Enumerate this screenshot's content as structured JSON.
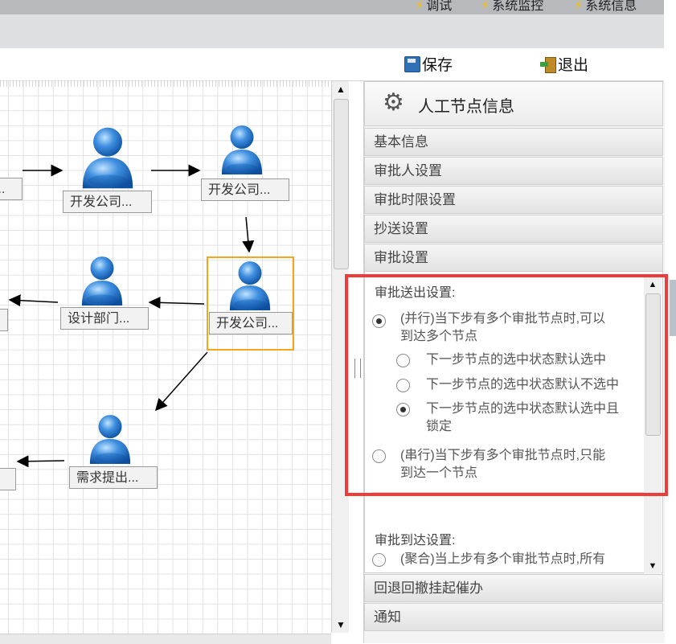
{
  "topbar": {
    "links": [
      {
        "label": "调试"
      },
      {
        "label": "系统监控"
      },
      {
        "label": "系统信息"
      }
    ]
  },
  "toolbar": {
    "save_label": "保存",
    "exit_label": "退出"
  },
  "workflow": {
    "nodes": [
      {
        "label": "..."
      },
      {
        "label": "开发公司..."
      },
      {
        "label": "开发公司..."
      },
      {
        "label": ""
      },
      {
        "label": "设计部门..."
      },
      {
        "label": "开发公司..."
      },
      {
        "label": "需求提出..."
      },
      {
        "label": "."
      }
    ]
  },
  "panel": {
    "title": "人工节点信息",
    "accordion": [
      {
        "label": "基本信息"
      },
      {
        "label": "审批人设置"
      },
      {
        "label": "审批时限设置"
      },
      {
        "label": "抄送设置"
      },
      {
        "label": "审批设置"
      }
    ],
    "send_settings": {
      "title": "审批送出设置:",
      "parallel": {
        "line1": "(并行)当下步有多个审批节点时,可以",
        "line2": "到达多个节点",
        "selected": true
      },
      "sub_options": [
        {
          "label": "下一步节点的选中状态默认选中",
          "selected": false
        },
        {
          "label": "下一步节点的选中状态默认不选中",
          "selected": false
        },
        {
          "label1": "下一步节点的选中状态默认选中且",
          "label2": "锁定",
          "selected": true
        }
      ],
      "serial": {
        "line1": "(串行)当下步有多个审批节点时,只能",
        "line2": "到达一个节点",
        "selected": false
      }
    },
    "arrive_settings": {
      "title": "审批到达设置:",
      "merge": {
        "line1": "(聚合)当上步有多个审批节点时,所有",
        "selected": false
      }
    },
    "accordion_bottom": [
      {
        "label": "回退回撤挂起催办"
      },
      {
        "label": "通知"
      }
    ]
  }
}
